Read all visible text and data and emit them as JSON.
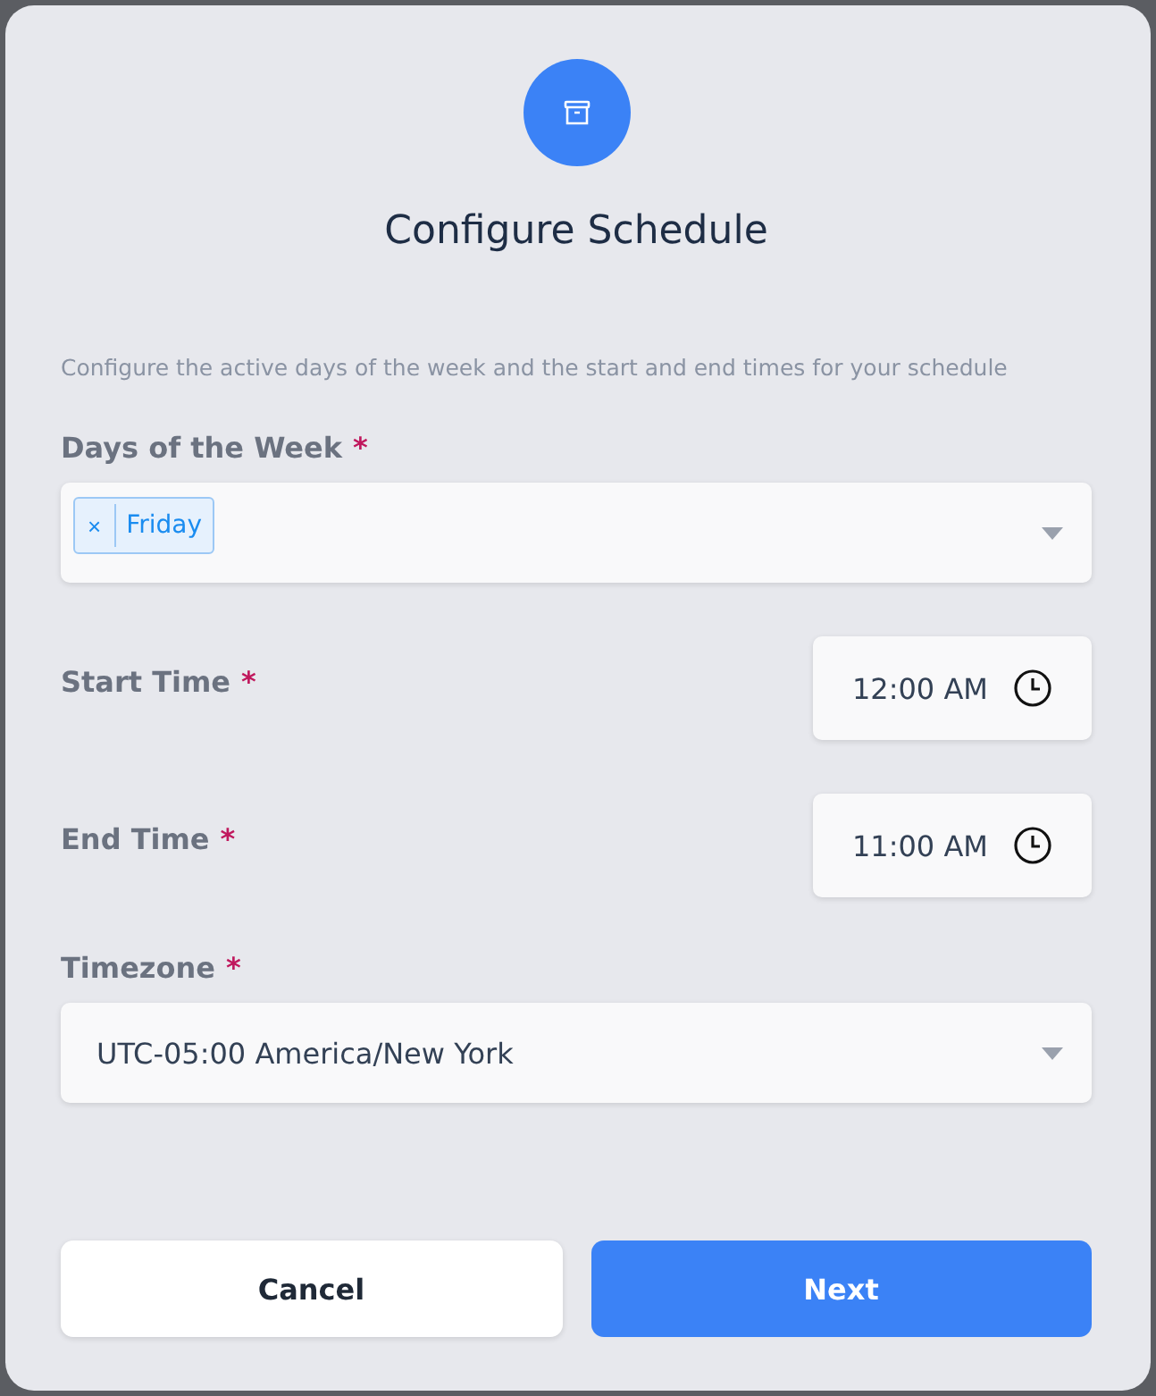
{
  "dialog": {
    "title": "Configure Schedule",
    "description": "Configure the active days of the week and the start and end times for your schedule"
  },
  "fields": [
    {
      "kind": "tags",
      "label": "Days of the Week",
      "required_mark": "*",
      "tags": [
        {
          "remove": "×",
          "label": "Friday"
        }
      ]
    },
    {
      "kind": "time",
      "label": "Start Time",
      "required_mark": "*",
      "value": "12:00  AM"
    },
    {
      "kind": "time",
      "label": "End Time",
      "required_mark": "*",
      "value": "11:00  AM"
    },
    {
      "kind": "select",
      "label": "Timezone",
      "required_mark": "*",
      "value": "UTC-05:00 America/New York"
    }
  ],
  "buttons": [
    {
      "label": "Cancel",
      "kind": "secondary"
    },
    {
      "label": "Next",
      "kind": "primary"
    }
  ]
}
